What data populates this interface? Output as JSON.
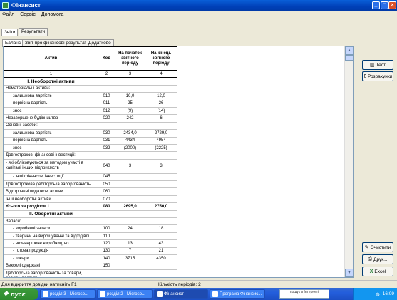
{
  "window": {
    "title": "Фінансист"
  },
  "menu": [
    "Файл",
    "Сервіс",
    "Допомога"
  ],
  "top_tabs": [
    "Звіти",
    "Результати"
  ],
  "sub_tabs": [
    "Баланс",
    "Звіт про фінансові результати",
    "Додатково"
  ],
  "table": {
    "headers": [
      "Актив",
      "Код",
      "На початок звітного періоду",
      "На кінець звітного періоду"
    ],
    "col_numbers": [
      "1",
      "2",
      "3",
      "4"
    ],
    "rows": [
      {
        "type": "section",
        "label": "І. Необоротні активи",
        "code": "",
        "begin": "",
        "end": ""
      },
      {
        "type": "normal",
        "label": "Нематеріальні активи:",
        "code": "",
        "begin": "",
        "end": ""
      },
      {
        "type": "indent",
        "label": "залишкова вартість",
        "code": "010",
        "begin": "16,0",
        "end": "12,0"
      },
      {
        "type": "indent",
        "label": "первісна вартість",
        "code": "011",
        "begin": "25",
        "end": "26"
      },
      {
        "type": "indent",
        "label": "знос",
        "code": "012",
        "begin": "(9)",
        "end": "(14)"
      },
      {
        "type": "normal",
        "label": "Незавершене будівництво",
        "code": "020",
        "begin": "242",
        "end": "6"
      },
      {
        "type": "normal",
        "label": "Основні засоби:",
        "code": "",
        "begin": "",
        "end": ""
      },
      {
        "type": "indent",
        "label": "залишкова вартість",
        "code": "030",
        "begin": "2434,0",
        "end": "2729,0"
      },
      {
        "type": "indent",
        "label": "первісна вартість",
        "code": "031",
        "begin": "4434",
        "end": "4954"
      },
      {
        "type": "indent",
        "label": "знос",
        "code": "032",
        "begin": "(2000)",
        "end": "(2225)"
      },
      {
        "type": "normal",
        "label": "Довгострокові фінансові інвестиції:",
        "code": "",
        "begin": "",
        "end": ""
      },
      {
        "type": "tall",
        "label": "- які обліковуються за методом участі в капіталі інших підприємств",
        "code": "040",
        "begin": "3",
        "end": "3"
      },
      {
        "type": "indent",
        "label": "- інші фінансові інвестиції",
        "code": "045",
        "begin": "",
        "end": ""
      },
      {
        "type": "normal",
        "label": "Довгострокова дебіторська заборгованість",
        "code": "050",
        "begin": "",
        "end": ""
      },
      {
        "type": "normal",
        "label": "Відстрочені податкові активи",
        "code": "060",
        "begin": "",
        "end": ""
      },
      {
        "type": "normal",
        "label": "Інші необоротні активи",
        "code": "070",
        "begin": "",
        "end": ""
      },
      {
        "type": "bold",
        "label": "Усього за розділом І",
        "code": "080",
        "begin": "2695,0",
        "end": "2750,0"
      },
      {
        "type": "section",
        "label": "ІІ. Оборотні активи",
        "code": "",
        "begin": "",
        "end": ""
      },
      {
        "type": "normal",
        "label": "Запаси:",
        "code": "",
        "begin": "",
        "end": ""
      },
      {
        "type": "indent",
        "label": "- виробничі запаси",
        "code": "100",
        "begin": "24",
        "end": "18"
      },
      {
        "type": "indent",
        "label": "- тварини на вирощуванні та відгодівлі",
        "code": "110",
        "begin": "",
        "end": ""
      },
      {
        "type": "indent",
        "label": "- незавершене виробництво",
        "code": "120",
        "begin": "13",
        "end": "43"
      },
      {
        "type": "indent",
        "label": "- готова продукція",
        "code": "130",
        "begin": "7",
        "end": "21"
      },
      {
        "type": "indent",
        "label": "- товари",
        "code": "140",
        "begin": "3715",
        "end": "4350"
      },
      {
        "type": "normal",
        "label": "Векселі одержані",
        "code": "150",
        "begin": "",
        "end": ""
      },
      {
        "type": "tall",
        "label": "Дебіторська заборгованість за товари, роботи, послуги",
        "code": "",
        "begin": "",
        "end": ""
      }
    ]
  },
  "right_buttons": {
    "test": "Тест",
    "calc": "Розрахунки",
    "clear": "Очистити",
    "print": "Друк...",
    "excel": "Excel"
  },
  "status": {
    "left": "Для відкриття довідки натисніть F1",
    "right": "Кількість періодів: 2"
  },
  "taskbar": {
    "start": "пуск",
    "tasks": [
      "розділ 3 - Microso...",
      "розділ 2 - Microso...",
      "Фінансист",
      "Програма Фінансис..."
    ],
    "lang_hint": "пошук в Інтернеті",
    "clock": "16:09"
  }
}
